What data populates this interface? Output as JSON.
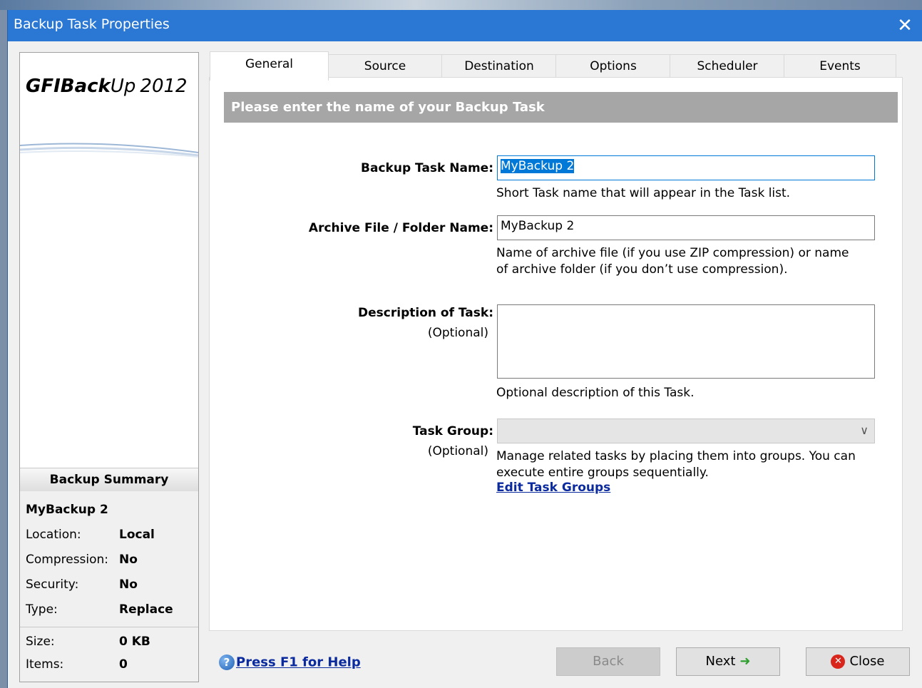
{
  "window": {
    "title": "Backup Task Properties"
  },
  "logo": {
    "brand": "GFI",
    "product": "BackUp",
    "product_a": "Back",
    "product_b": "Up",
    "year": "2012"
  },
  "summary": {
    "heading": "Backup Summary",
    "task_name": "MyBackup 2",
    "rows": [
      {
        "label": "Location:",
        "value": "Local"
      },
      {
        "label": "Compression:",
        "value": "No"
      },
      {
        "label": "Security:",
        "value": "No"
      },
      {
        "label": "Type:",
        "value": "Replace"
      },
      {
        "label": "Size:",
        "value": "0 KB"
      },
      {
        "label": "Items:",
        "value": "0"
      }
    ]
  },
  "tabs": [
    {
      "label": "General",
      "active": true
    },
    {
      "label": "Source"
    },
    {
      "label": "Destination"
    },
    {
      "label": "Options"
    },
    {
      "label": "Scheduler"
    },
    {
      "label": "Events"
    }
  ],
  "general": {
    "banner": "Please enter the name of your Backup Task",
    "task_name_label": "Backup Task Name:",
    "task_name_value": "MyBackup 2",
    "task_name_hint": "Short Task name that will appear in the Task list.",
    "archive_label": "Archive File / Folder Name:",
    "archive_value": "MyBackup 2",
    "archive_hint_1": "Name of archive file (if you use ZIP compression) or name",
    "archive_hint_2": "of archive folder (if you don’t use compression).",
    "description_label": "Description of Task:",
    "optional": "(Optional)",
    "description_value": "",
    "description_hint": "Optional description of this Task.",
    "group_label": "Task Group:",
    "group_value": "",
    "group_hint_1": "Manage related tasks by placing them into groups. You can",
    "group_hint_2": "execute entire groups sequentially.",
    "edit_groups_link": "Edit Task Groups"
  },
  "footer": {
    "help": "Press F1 for Help",
    "back": "Back",
    "next": "Next",
    "close": "Close"
  },
  "colors": {
    "titlebar": "#2b78d4",
    "banner": "#a6a6a6",
    "link": "#0a2a9e"
  }
}
